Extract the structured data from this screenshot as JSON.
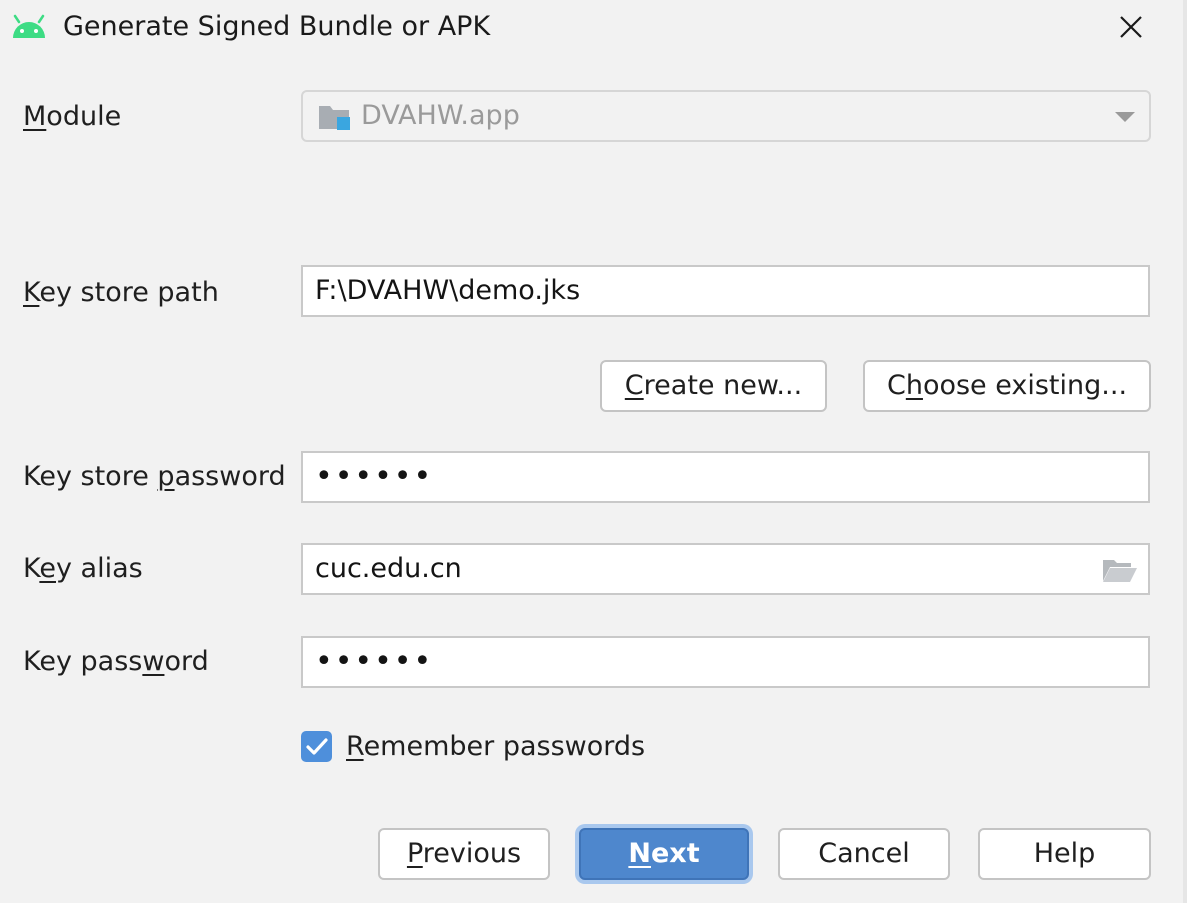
{
  "window": {
    "title": "Generate Signed Bundle or APK",
    "app_icon": "android-icon",
    "close_icon": "close-icon"
  },
  "module": {
    "label_first": "M",
    "label_rest": "odule",
    "value": "DVAHW.app",
    "icon": "module-folder-icon"
  },
  "key_store_path": {
    "label_first": "K",
    "label_rest": "ey store path",
    "value": "F:\\DVAHW\\demo.jks"
  },
  "buttons": {
    "create_new_first": "C",
    "create_new_rest": "reate new...",
    "choose_existing_pre": "C",
    "choose_existing_u": "h",
    "choose_existing_rest": "oose existing...",
    "previous_first": "P",
    "previous_rest": "revious",
    "next_first": "N",
    "next_rest": "ext",
    "cancel": "Cancel",
    "help": "Help"
  },
  "key_store_password": {
    "label_pre": "Key store ",
    "label_u": "p",
    "label_rest": "assword",
    "value": "••••••"
  },
  "key_alias": {
    "label_pre": "K",
    "label_u": "e",
    "label_rest": "y alias",
    "value": "cuc.edu.cn",
    "icon": "folder-open-icon"
  },
  "key_password": {
    "label_pre": "Key pass",
    "label_u": "w",
    "label_rest": "ord",
    "value": "••••••"
  },
  "remember": {
    "label_first": "R",
    "label_rest": "emember passwords",
    "checked": true
  },
  "colors": {
    "accent": "#4e87cd",
    "checkbox": "#4e8fdb",
    "android_green": "#3ddc84"
  }
}
